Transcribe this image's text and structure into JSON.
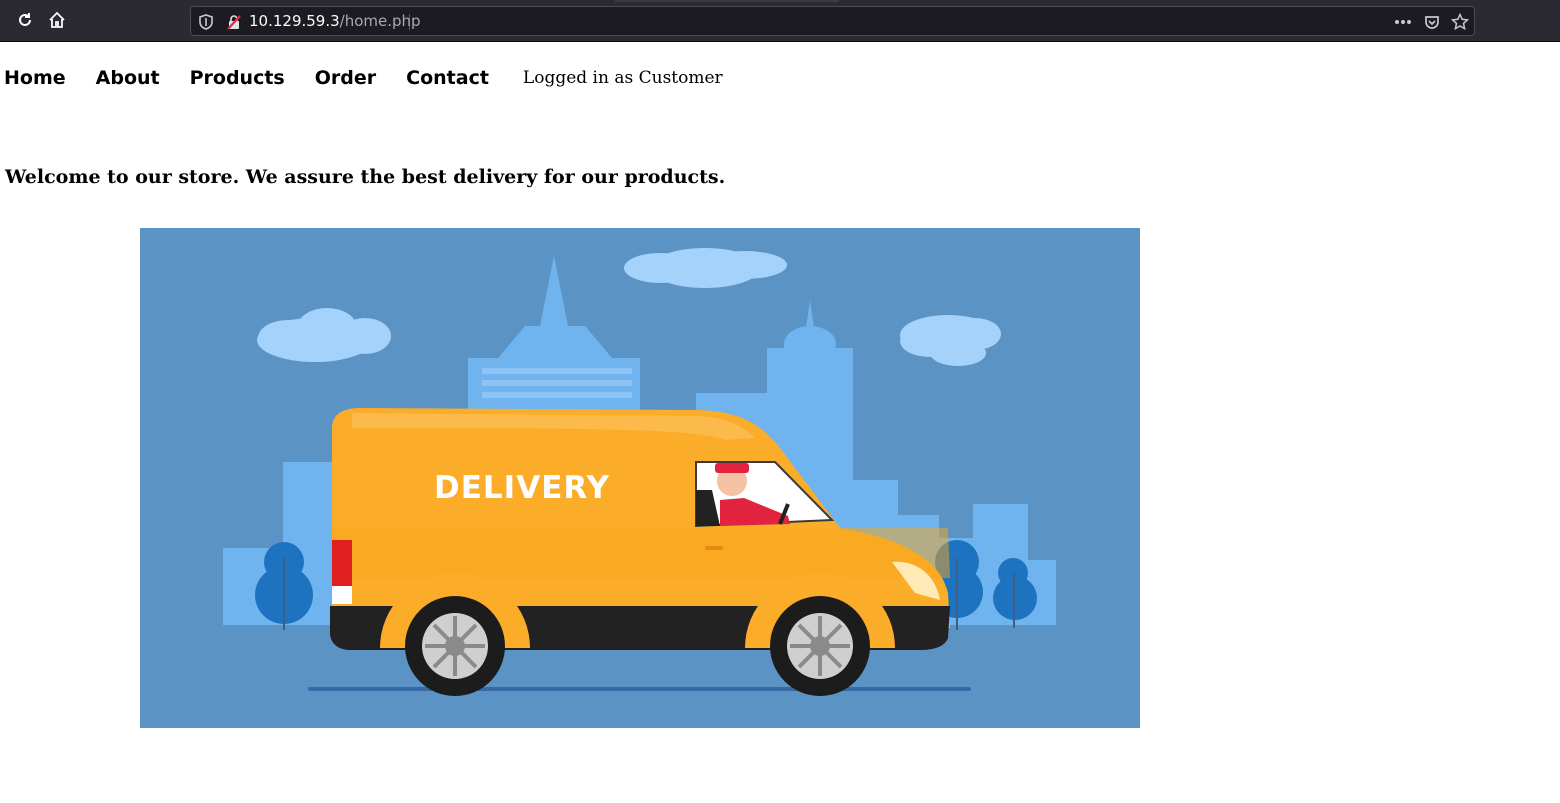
{
  "browser": {
    "url_host": "10.129.59.3",
    "url_path": "/home.php",
    "icons": [
      "reload-icon",
      "home-icon",
      "shield-icon",
      "insecure-lock-icon",
      "more-icon",
      "pocket-icon",
      "bookmark-star-icon"
    ]
  },
  "nav": {
    "home": "Home",
    "about": "About",
    "products": "Products",
    "order": "Order",
    "contact": "Contact",
    "status": "Logged in as Customer"
  },
  "main": {
    "welcome": "Welcome to our store. We assure the best delivery for our products.",
    "hero_text": "DELIVERY"
  },
  "colors": {
    "sky": "#5b93c4",
    "buildings": "#6fb4ef",
    "van": "#fbac28",
    "trees": "#1e73c0"
  }
}
